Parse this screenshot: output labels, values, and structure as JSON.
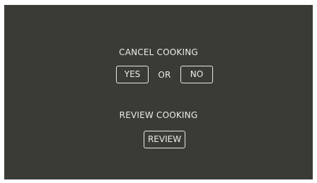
{
  "cancel": {
    "label": "CANCEL COOKING",
    "yes_label": "YES",
    "or_label": "OR",
    "no_label": "NO"
  },
  "review": {
    "label": "REVIEW COOKING",
    "button_label": "REVIEW"
  },
  "colors": {
    "background": "#3a3b36",
    "text": "#ecece8",
    "border": "#e8e8e4"
  }
}
